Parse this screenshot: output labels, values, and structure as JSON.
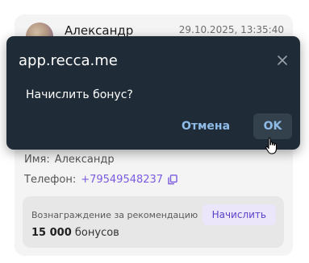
{
  "card": {
    "user_name": "Александр",
    "timestamp": "29.10.2025, 13:35:40",
    "name_label": "Имя:",
    "name_value": "Александр",
    "phone_label": "Телефон:",
    "phone_value": "+79549548237",
    "reward": {
      "label": "Вознаграждение за рекомендацию",
      "button_label": "Начислить",
      "amount_number": "15 000",
      "amount_unit": "бонусов"
    }
  },
  "dialog": {
    "title": "app.recca.me",
    "message": "Начислить бонус?",
    "cancel_label": "Отмена",
    "ok_label": "OK",
    "close_icon": "close-icon"
  },
  "colors": {
    "dialog_bg": "#1f2b36",
    "dialog_button_text": "#8fbbe8",
    "accent_purple": "#7a5be0",
    "card_bg": "#f4f4f4"
  }
}
